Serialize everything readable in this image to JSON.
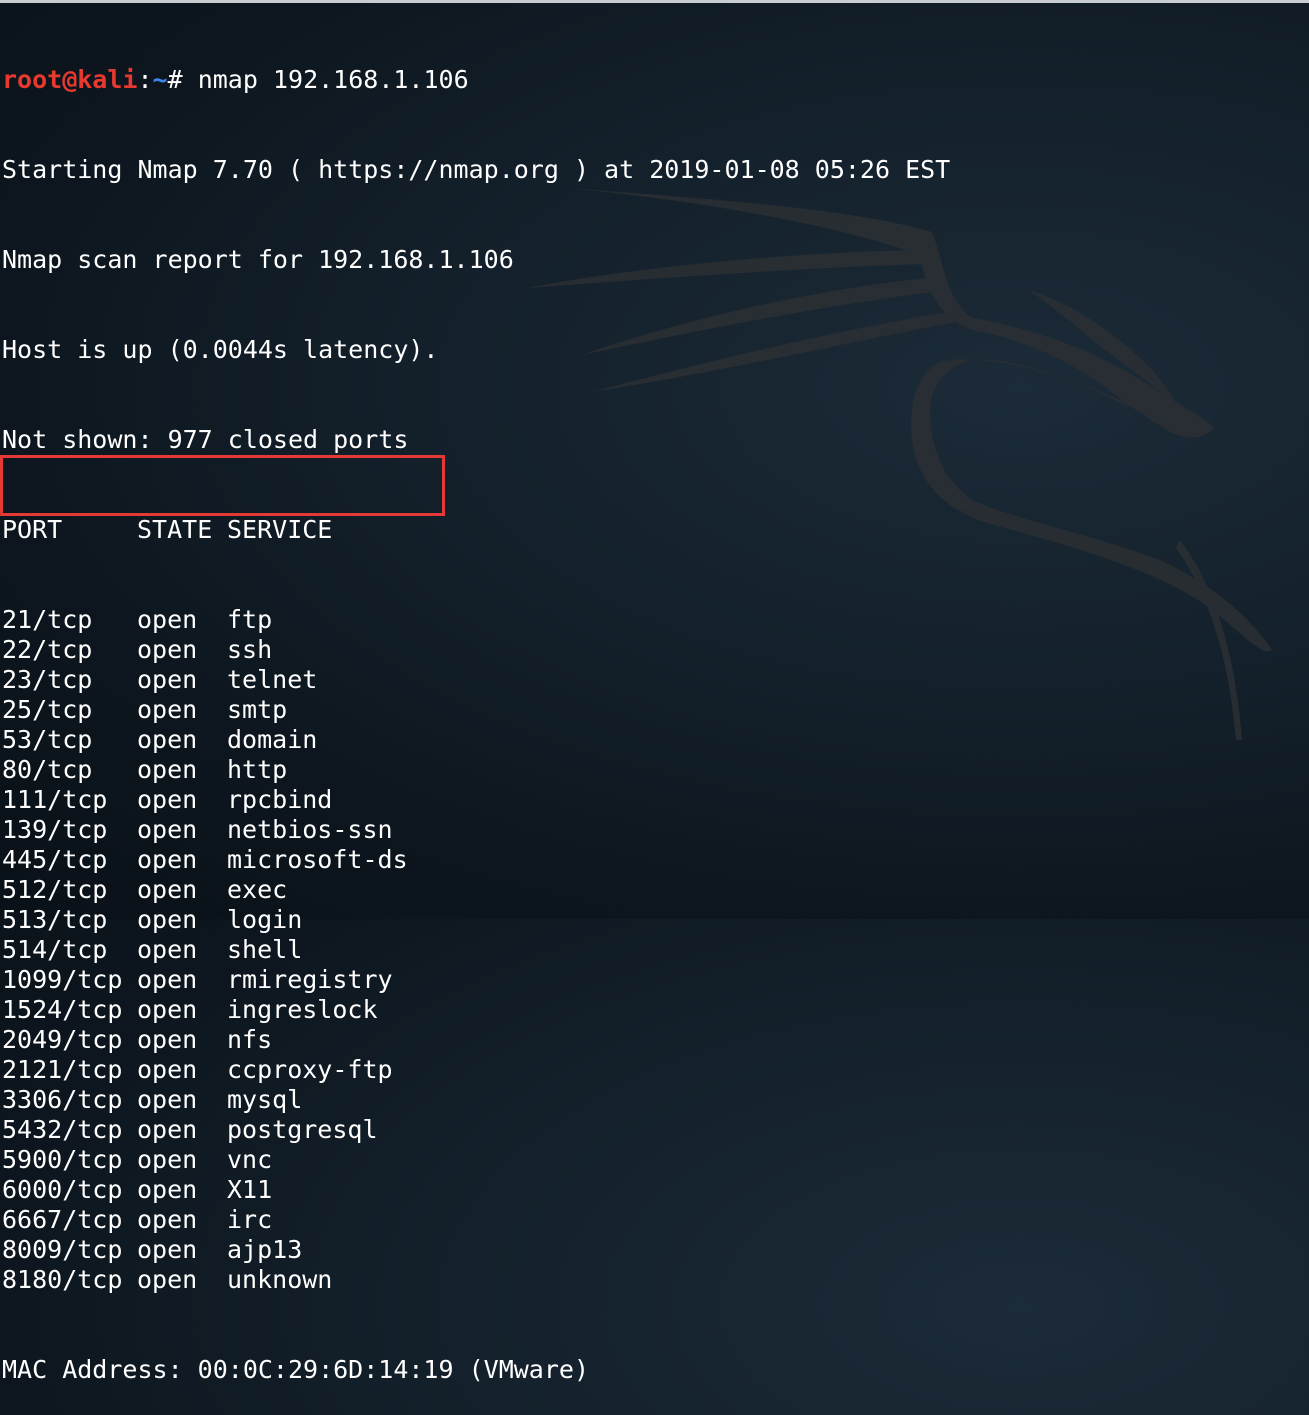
{
  "prompt": {
    "user_host": "root@kali",
    "colon": ":",
    "path": "~",
    "hash": "#",
    "command": " nmap 192.168.1.106"
  },
  "output": {
    "starting": "Starting Nmap 7.70 ( https://nmap.org ) at 2019-01-08 05:26 EST",
    "report": "Nmap scan report for 192.168.1.106",
    "host_up": "Host is up (0.0044s latency).",
    "not_shown": "Not shown: 977 closed ports"
  },
  "ports_table": {
    "headers": [
      "PORT",
      "STATE",
      "SERVICE"
    ],
    "rows": [
      {
        "port": "21/tcp",
        "state": "open",
        "service": "ftp"
      },
      {
        "port": "22/tcp",
        "state": "open",
        "service": "ssh"
      },
      {
        "port": "23/tcp",
        "state": "open",
        "service": "telnet"
      },
      {
        "port": "25/tcp",
        "state": "open",
        "service": "smtp"
      },
      {
        "port": "53/tcp",
        "state": "open",
        "service": "domain"
      },
      {
        "port": "80/tcp",
        "state": "open",
        "service": "http"
      },
      {
        "port": "111/tcp",
        "state": "open",
        "service": "rpcbind"
      },
      {
        "port": "139/tcp",
        "state": "open",
        "service": "netbios-ssn"
      },
      {
        "port": "445/tcp",
        "state": "open",
        "service": "microsoft-ds"
      },
      {
        "port": "512/tcp",
        "state": "open",
        "service": "exec"
      },
      {
        "port": "513/tcp",
        "state": "open",
        "service": "login"
      },
      {
        "port": "514/tcp",
        "state": "open",
        "service": "shell"
      },
      {
        "port": "1099/tcp",
        "state": "open",
        "service": "rmiregistry"
      },
      {
        "port": "1524/tcp",
        "state": "open",
        "service": "ingreslock"
      },
      {
        "port": "2049/tcp",
        "state": "open",
        "service": "nfs"
      },
      {
        "port": "2121/tcp",
        "state": "open",
        "service": "ccproxy-ftp"
      },
      {
        "port": "3306/tcp",
        "state": "open",
        "service": "mysql"
      },
      {
        "port": "5432/tcp",
        "state": "open",
        "service": "postgresql"
      },
      {
        "port": "5900/tcp",
        "state": "open",
        "service": "vnc"
      },
      {
        "port": "6000/tcp",
        "state": "open",
        "service": "X11"
      },
      {
        "port": "6667/tcp",
        "state": "open",
        "service": "irc"
      },
      {
        "port": "8009/tcp",
        "state": "open",
        "service": "ajp13"
      },
      {
        "port": "8180/tcp",
        "state": "open",
        "service": "unknown"
      }
    ]
  },
  "mac_line": "MAC Address: 00:0C:29:6D:14:19 (VMware)",
  "colors": {
    "prompt_user": "#e8392f",
    "prompt_path": "#3d86e8",
    "text": "#ffffff",
    "highlight_box": "#e53935",
    "background": "#0d161e"
  },
  "icons": {
    "background_logo": "kali-dragon-icon"
  }
}
